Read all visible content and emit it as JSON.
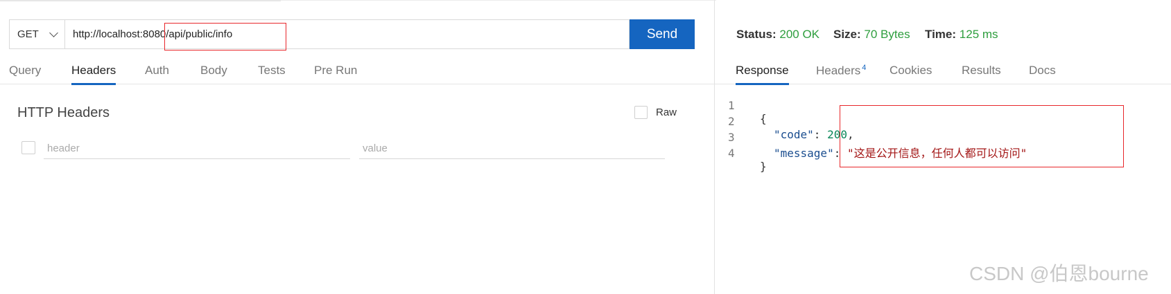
{
  "request": {
    "method": "GET",
    "url": "http://localhost:8080/api/public/info",
    "send_label": "Send"
  },
  "request_tabs": [
    {
      "label": "Query"
    },
    {
      "label": "Headers"
    },
    {
      "label": "Auth"
    },
    {
      "label": "Body"
    },
    {
      "label": "Tests"
    },
    {
      "label": "Pre Run"
    }
  ],
  "headers_panel": {
    "title": "HTTP Headers",
    "raw_label": "Raw",
    "header_placeholder": "header",
    "value_placeholder": "value"
  },
  "status": {
    "status_label": "Status:",
    "status_value": "200 OK",
    "size_label": "Size:",
    "size_value": "70 Bytes",
    "time_label": "Time:",
    "time_value": "125 ms"
  },
  "response_tabs": [
    {
      "label": "Response"
    },
    {
      "label": "Headers",
      "badge": "4"
    },
    {
      "label": "Cookies"
    },
    {
      "label": "Results"
    },
    {
      "label": "Docs"
    }
  ],
  "response_body": {
    "line_numbers": [
      "1",
      "2",
      "3",
      "4"
    ],
    "open_brace": "{",
    "close_brace": "}",
    "code_key": "\"code\"",
    "code_value": "200",
    "message_key": "\"message\"",
    "message_value": "\"这是公开信息，任何人都可以访问\""
  },
  "watermark": "CSDN @伯恩bourne",
  "colors": {
    "accent": "#1565c0",
    "status_ok": "#2e9e3e",
    "highlight_box": "#e8262a"
  }
}
